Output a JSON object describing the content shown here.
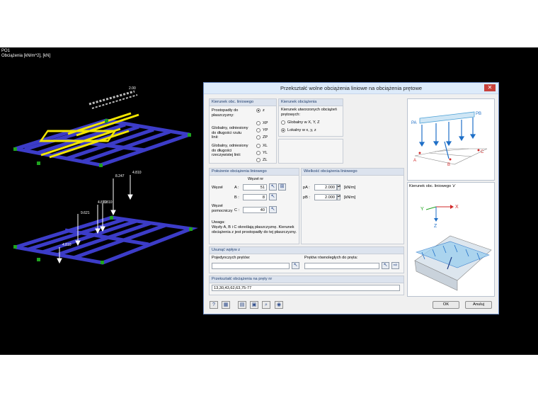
{
  "viewport": {
    "case_label": "PO1",
    "units_label": "Obciążenia [kN/m^2], [kN]",
    "load_labels": [
      "2.00",
      "8.247",
      "4.810",
      "9.621",
      "4.810",
      "6.810",
      "4.810"
    ]
  },
  "dialog": {
    "title": "Przekształć wolne obciążenia liniowe na obciążenia prętowe",
    "close": "✕",
    "direction_group": {
      "title": "Kierunek obc. liniowego",
      "perpendicular_label": "Prostopadły do płaszczyzny:",
      "global_proj_label": "Globalny, odniesiony do długości rzutu linii:",
      "global_true_label": "Globalny, odniesiony do długości rzeczywistej linii:",
      "options": [
        "z",
        "XP",
        "YP",
        "ZP",
        "XL",
        "YL",
        "ZL"
      ]
    },
    "load_dir_group": {
      "title": "Kierunek obciążenia",
      "desc": "Kierunek utworzonych obciążeń prętowych:",
      "options": [
        "Globalny w X, Y, Z",
        "Lokalny w x, y, z"
      ]
    },
    "position_group": {
      "title": "Położenie obciążenia liniowego",
      "node_no": "Węzeł nr",
      "node_label": "Węzeł",
      "a_label": "A :",
      "a_value": "51",
      "b_label": "B :",
      "b_value": "8",
      "aux_label": "Węzeł pomocniczy",
      "c_label": "C :",
      "c_value": "40",
      "note_title": "Uwaga:",
      "note_text": "Węzły A, B i C określają płaszczyznę. Kierunek obciążenia z jest prostopadły do tej płaszczyzny."
    },
    "magnitude_group": {
      "title": "Wielkość obciążenia liniowego",
      "pa_label": "pA :",
      "pa_value": "2.000",
      "pb_label": "pB :",
      "pb_value": "2.000",
      "unit": "[kN/m]"
    },
    "remove_group": {
      "title": "Usunąć wpływ z",
      "single_label": "Pojedynczych prętów:",
      "single_value": "",
      "parallel_label": "Prętów równoległych do pręta:",
      "parallel_value": ""
    },
    "convert_group": {
      "title": "Przekształć obciążenia na pręty nr",
      "value": "13,30,43,62,63,75-77"
    },
    "diagram1": {
      "pa": "PA",
      "pb": "PB",
      "a": "A",
      "b": "B",
      "c": "C"
    },
    "diagram2": {
      "title": "Kierunek obc. liniowego 'z'",
      "x": "X",
      "y": "Y",
      "z": "Z"
    },
    "ok_label": "OK",
    "cancel_label": "Anuluj"
  },
  "colors": {
    "beam": "#3c3cc8",
    "highlight": "#f2e600",
    "support": "#1fa31f",
    "dialog_header": "#dce3ee",
    "close": "#c7413b"
  }
}
